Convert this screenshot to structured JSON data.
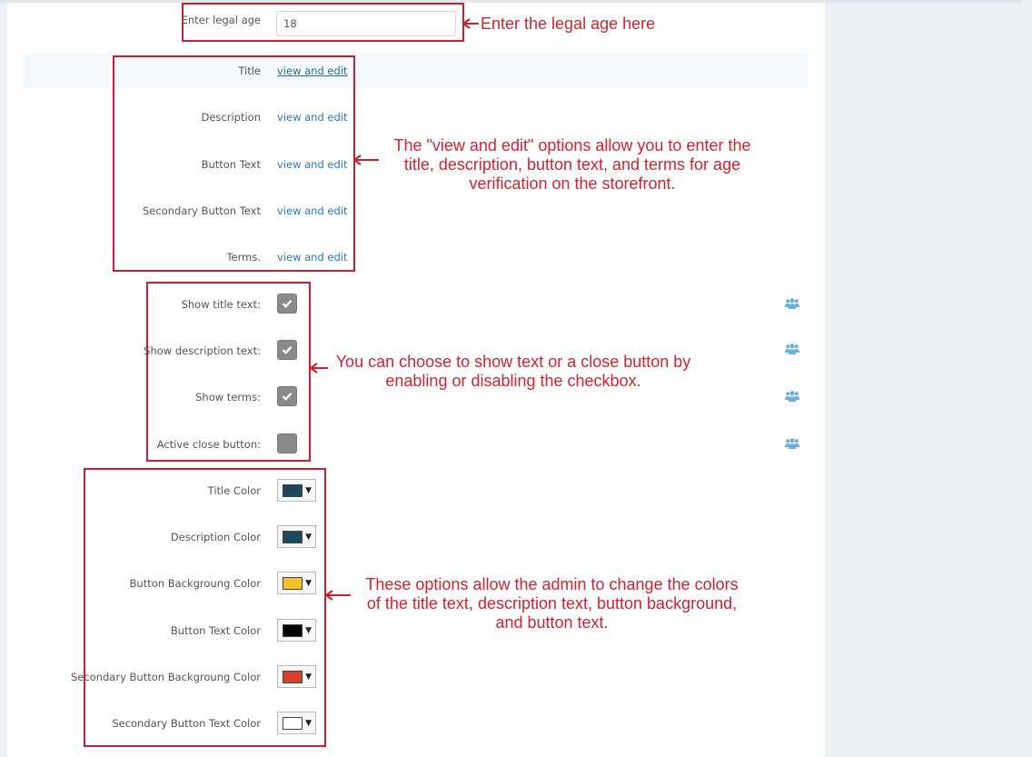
{
  "age": {
    "label": "Enter legal age",
    "value": "18"
  },
  "texts": [
    {
      "label": "Title",
      "link": "view and edit"
    },
    {
      "label": "Description",
      "link": "view and edit"
    },
    {
      "label": "Button Text",
      "link": "view and edit"
    },
    {
      "label": "Secondary Button Text",
      "link": "view and edit"
    },
    {
      "label": "Terms.",
      "link": "view and edit"
    }
  ],
  "checkboxes": [
    {
      "label": "Show title text:",
      "checked": true
    },
    {
      "label": "Show description text:",
      "checked": true
    },
    {
      "label": "Show terms:",
      "checked": true
    },
    {
      "label": "Active close button:",
      "checked": false
    }
  ],
  "colors": [
    {
      "label": "Title Color",
      "color": "#1b4a5c"
    },
    {
      "label": "Description Color",
      "color": "#1b4a5c"
    },
    {
      "label": "Button Backgroung Color",
      "color": "#f2c230"
    },
    {
      "label": "Button Text Color",
      "color": "#000000"
    },
    {
      "label": "Secondary Button Backgroung Color",
      "color": "#d3432b"
    },
    {
      "label": "Secondary Button Text Color",
      "color": "#ffffff"
    }
  ],
  "annotations": {
    "age": "Enter the legal age here",
    "texts": [
      "The \"view and edit\" options allow you to enter the",
      "title, description, button text, and terms for age",
      "verification on the storefront."
    ],
    "checkboxes": [
      "You can choose to show text or a close button by",
      "enabling or disabling the checkbox."
    ],
    "colors": [
      "These options allow the admin to change the colors",
      "of the title text, description text, button background,",
      "and button text."
    ]
  },
  "icons": {
    "check": "check-icon",
    "users": "users-icon",
    "caret": "caret-down-icon"
  },
  "accent": {
    "annotation": "#c8202f",
    "link": "#2a7ab8",
    "users_icon": "#6bb0de"
  }
}
